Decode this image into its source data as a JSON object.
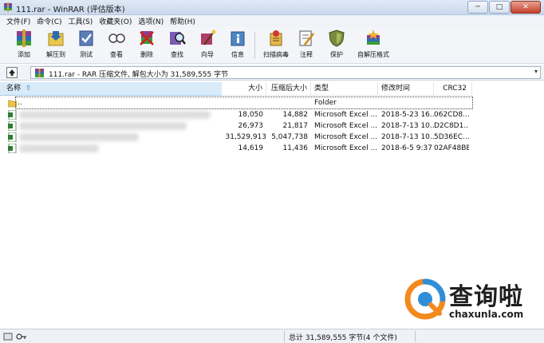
{
  "window": {
    "title": "111.rar - WinRAR (评估版本)",
    "controls": {
      "minimize": "─",
      "maximize": "□",
      "close": "✕"
    }
  },
  "menu": [
    "文件(F)",
    "命令(C)",
    "工具(S)",
    "收藏夹(O)",
    "选项(N)",
    "帮助(H)"
  ],
  "toolbar": {
    "buttons": [
      {
        "label": "添加",
        "icon": "add-archive-icon"
      },
      {
        "label": "解压到",
        "icon": "extract-to-icon"
      },
      {
        "label": "测试",
        "icon": "test-icon"
      },
      {
        "label": "查看",
        "icon": "view-icon"
      },
      {
        "label": "删除",
        "icon": "delete-icon"
      },
      {
        "label": "查找",
        "icon": "find-icon"
      },
      {
        "label": "向导",
        "icon": "wizard-icon"
      },
      {
        "label": "信息",
        "icon": "info-icon"
      },
      {
        "label": "扫描病毒",
        "icon": "virus-scan-icon"
      },
      {
        "label": "注释",
        "icon": "comment-icon"
      },
      {
        "label": "保护",
        "icon": "protect-icon"
      },
      {
        "label": "自解压格式",
        "icon": "sfx-icon"
      }
    ]
  },
  "address": {
    "text": "111.rar - RAR 压缩文件, 解包大小为 31,589,555 字节",
    "dropdown": "▾"
  },
  "columns": {
    "name": "名称",
    "sort_indicator": "⇧",
    "size": "大小",
    "packed": "压缩后大小",
    "type": "类型",
    "modified": "修改时间",
    "crc": "CRC32"
  },
  "rows": [
    {
      "name": "..",
      "size": "",
      "packed": "",
      "type": "Folder",
      "modified": "",
      "crc": "",
      "kind": "folder"
    },
    {
      "name": "",
      "size": "18,050",
      "packed": "14,882",
      "type": "Microsoft Excel ...",
      "modified": "2018-5-23 16...",
      "crc": "062CD8...",
      "kind": "excel"
    },
    {
      "name": "",
      "size": "26,973",
      "packed": "21,817",
      "type": "Microsoft Excel ...",
      "modified": "2018-7-13 10...",
      "crc": "D2C8D1...",
      "kind": "excel"
    },
    {
      "name": "",
      "size": "31,529,913",
      "packed": "5,047,738",
      "type": "Microsoft Excel ...",
      "modified": "2018-7-13 10...",
      "crc": "5D36EC...",
      "kind": "excel"
    },
    {
      "name": "",
      "size": "14,619",
      "packed": "11,436",
      "type": "Microsoft Excel ...",
      "modified": "2018-6-5 9:37",
      "crc": "02AF48BB",
      "kind": "excel"
    }
  ],
  "status": {
    "text": "总计 31,589,555 字节(4 个文件)"
  },
  "watermark": {
    "title": "查询啦",
    "url": "chaxunla.com"
  },
  "colors": {
    "accent": "#d9ebf9",
    "watermark_orange": "#f28a1e",
    "watermark_blue": "#2e8fd8"
  }
}
